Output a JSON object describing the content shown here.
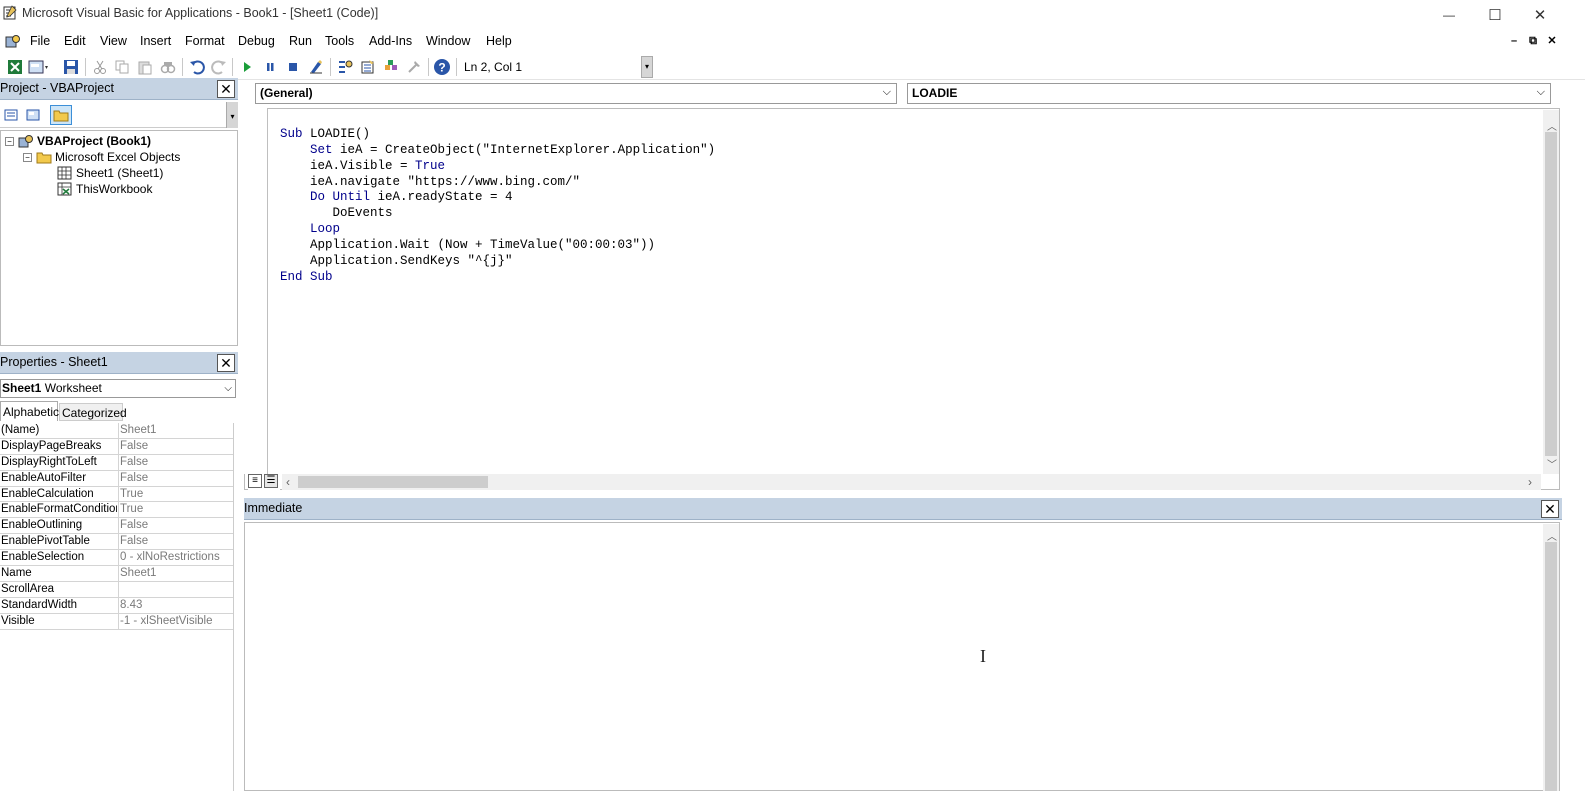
{
  "window": {
    "title": "Microsoft Visual Basic for Applications - Book1 - [Sheet1 (Code)]",
    "minimize": "—",
    "maximize": "☐",
    "close": "✕"
  },
  "menu": {
    "items": [
      {
        "label": "File"
      },
      {
        "label": "Edit"
      },
      {
        "label": "View"
      },
      {
        "label": "Insert"
      },
      {
        "label": "Format"
      },
      {
        "label": "Debug"
      },
      {
        "label": "Run"
      },
      {
        "label": "Tools"
      },
      {
        "label": "Add-Ins"
      },
      {
        "label": "Window"
      },
      {
        "label": "Help"
      }
    ],
    "mdi_minimize": "–",
    "mdi_restore": "⧉",
    "mdi_close": "✕"
  },
  "toolbar": {
    "position": "Ln 2, Col 1",
    "icons": [
      "excel-icon",
      "insert-userform-icon",
      "save-icon",
      "cut-icon",
      "copy-icon",
      "paste-icon",
      "find-icon",
      "undo-icon",
      "redo-icon",
      "run-icon",
      "break-icon",
      "reset-icon",
      "design-mode-icon",
      "project-explorer-icon",
      "properties-window-icon",
      "object-browser-icon",
      "toolbox-icon",
      "help-icon"
    ]
  },
  "project_explorer": {
    "title": "Project - VBAProject",
    "close": "✕",
    "tree": {
      "root": "VBAProject (Book1)",
      "folder": "Microsoft Excel Objects",
      "items": [
        "Sheet1 (Sheet1)",
        "ThisWorkbook"
      ]
    }
  },
  "properties": {
    "title": "Properties - Sheet1",
    "close": "✕",
    "object_name": "Sheet1",
    "object_type": "Worksheet",
    "tabs": [
      "Alphabetic",
      "Categorized"
    ],
    "rows": [
      {
        "name": "(Name)",
        "value": "Sheet1"
      },
      {
        "name": "DisplayPageBreaks",
        "value": "False"
      },
      {
        "name": "DisplayRightToLeft",
        "value": "False"
      },
      {
        "name": "EnableAutoFilter",
        "value": "False"
      },
      {
        "name": "EnableCalculation",
        "value": "True"
      },
      {
        "name": "EnableFormatConditionsCalculation",
        "value": "True"
      },
      {
        "name": "EnableOutlining",
        "value": "False"
      },
      {
        "name": "EnablePivotTable",
        "value": "False"
      },
      {
        "name": "EnableSelection",
        "value": "0 - xlNoRestrictions"
      },
      {
        "name": "Name",
        "value": "Sheet1"
      },
      {
        "name": "ScrollArea",
        "value": ""
      },
      {
        "name": "StandardWidth",
        "value": "8.43"
      },
      {
        "name": "Visible",
        "value": "-1 - xlSheetVisible"
      }
    ]
  },
  "code_window": {
    "object_combo": "(General)",
    "procedure_combo": "LOADIE",
    "lines": [
      [
        {
          "t": "Sub",
          "k": true
        },
        {
          "t": " LOADIE()",
          "k": false
        }
      ],
      [
        {
          "t": "    ",
          "k": false
        },
        {
          "t": "Set",
          "k": true
        },
        {
          "t": " ieA = CreateObject(\"InternetExplorer.Application\")",
          "k": false
        }
      ],
      [
        {
          "t": "    ieA.Visible = ",
          "k": false
        },
        {
          "t": "True",
          "k": true
        }
      ],
      [
        {
          "t": "    ieA.navigate \"https://www.bing.com/\"",
          "k": false
        }
      ],
      [
        {
          "t": "    ",
          "k": false
        },
        {
          "t": "Do Until",
          "k": true
        },
        {
          "t": " ieA.readyState = 4",
          "k": false
        }
      ],
      [
        {
          "t": "       DoEvents",
          "k": false
        }
      ],
      [
        {
          "t": "    ",
          "k": false
        },
        {
          "t": "Loop",
          "k": true
        }
      ],
      [
        {
          "t": "    Application.Wait (Now + TimeValue(\"00:00:03\"))",
          "k": false
        }
      ],
      [
        {
          "t": "    Application.SendKeys \"^{j}\"",
          "k": false
        }
      ],
      [
        {
          "t": "End Sub",
          "k": true
        }
      ]
    ]
  },
  "immediate": {
    "title": "Immediate",
    "close": "✕"
  },
  "colors": {
    "panel_header": "#c5d3e3",
    "keyword": "#00008b",
    "property_value": "#7a7a7a"
  }
}
